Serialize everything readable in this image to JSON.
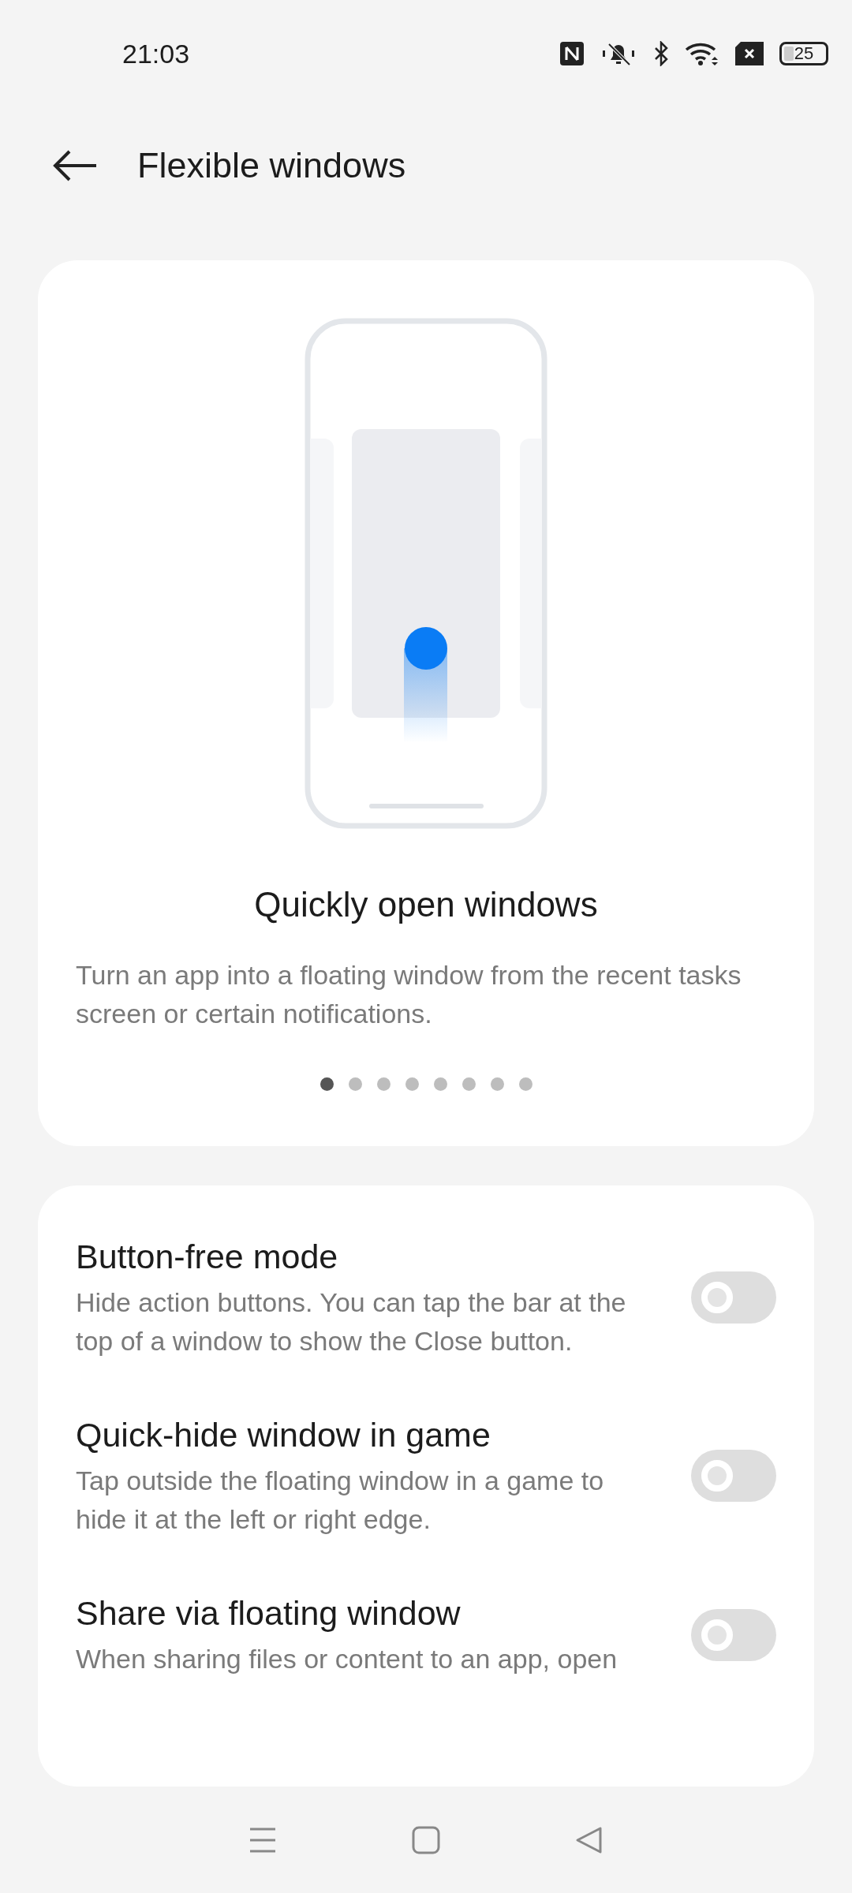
{
  "status_bar": {
    "time": "21:03",
    "battery": "25"
  },
  "header": {
    "title": "Flexible windows"
  },
  "feature_card": {
    "title": "Quickly open windows",
    "description": "Turn an app into a floating window from the recent tasks screen or certain notifications.",
    "pages": [
      {
        "selected": true
      },
      {
        "selected": false
      },
      {
        "selected": false
      },
      {
        "selected": false
      },
      {
        "selected": false
      },
      {
        "selected": false
      },
      {
        "selected": false
      },
      {
        "selected": false
      }
    ]
  },
  "settings": [
    {
      "title": "Button-free mode",
      "description": "Hide action buttons. You can tap the bar at the top of a window to show the Close button.",
      "on": false
    },
    {
      "title": "Quick-hide window in game",
      "description": "Tap outside the floating window in a game to hide it at the left or right edge.",
      "on": false
    },
    {
      "title": "Share via floating window",
      "description": "When sharing files or content to an app, open",
      "on": false
    }
  ]
}
